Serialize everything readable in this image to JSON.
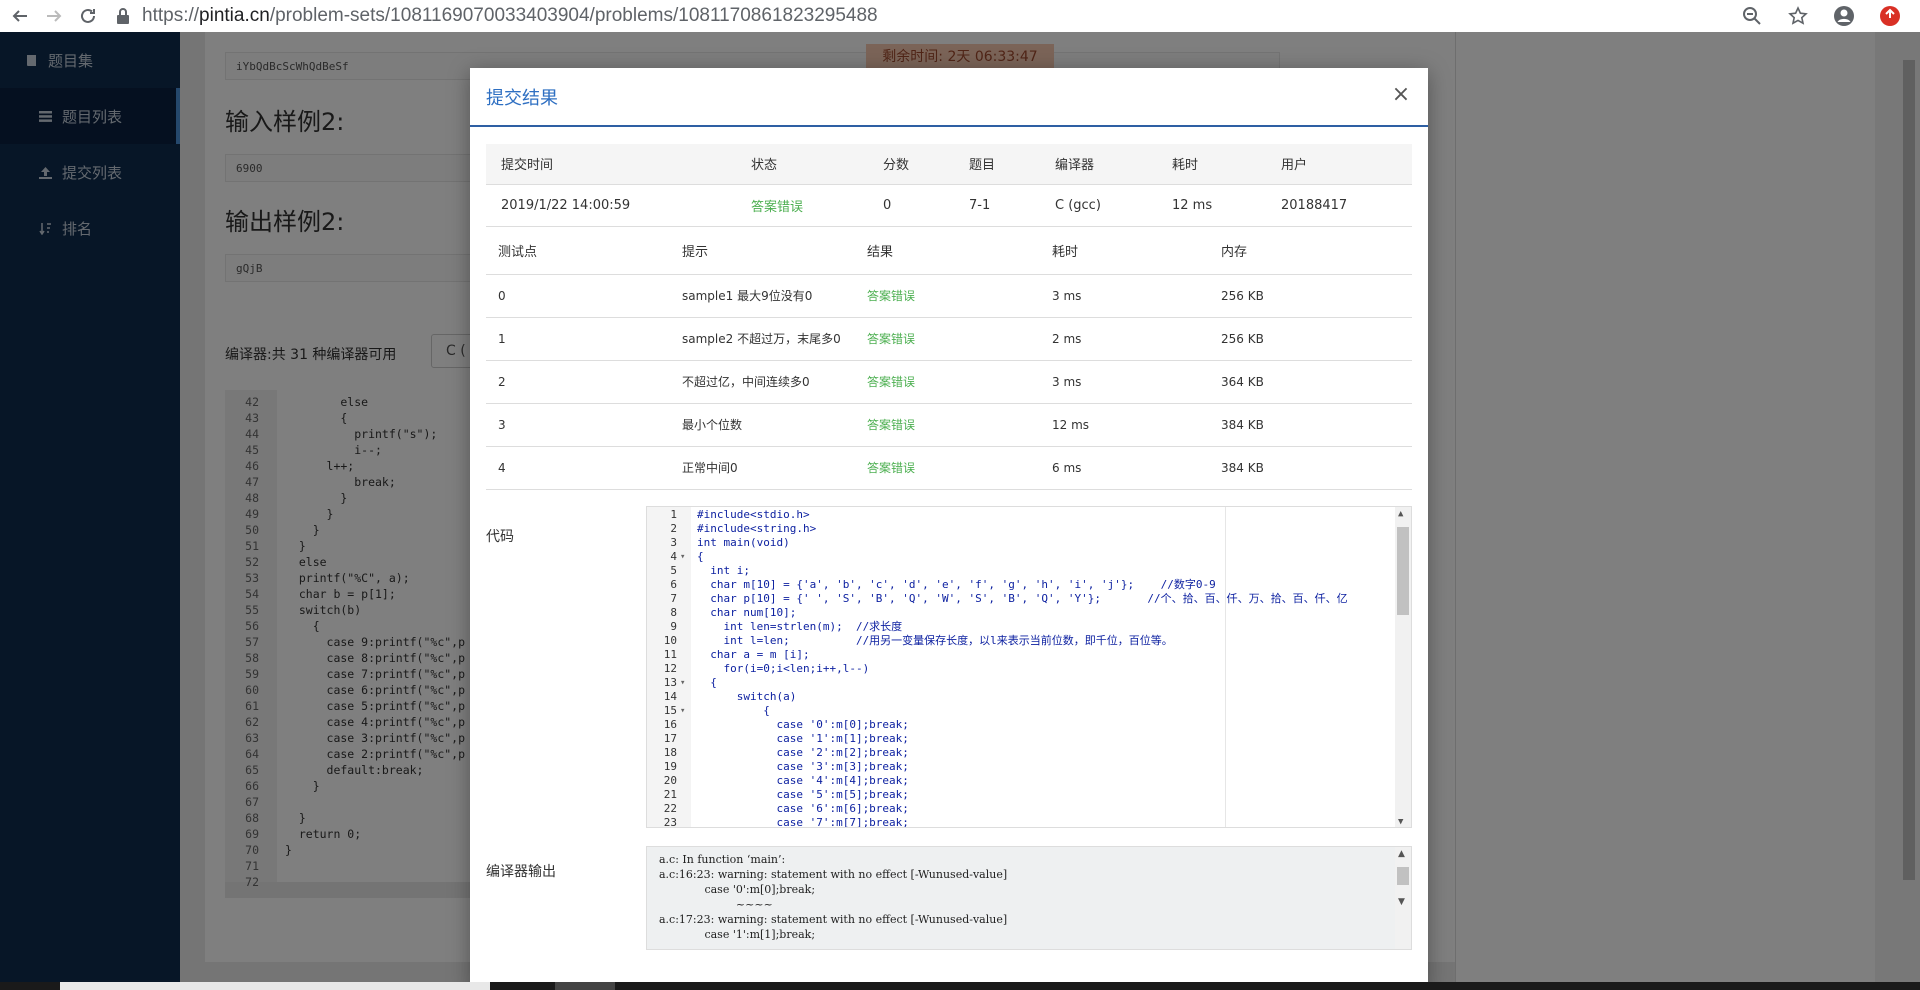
{
  "browser": {
    "url_scheme": "https://",
    "url_host": "pintia.cn",
    "url_path": "/problem-sets/1081169070033403904/problems/1081170861823295488"
  },
  "sidebar": {
    "items": [
      {
        "label": "题目集"
      },
      {
        "label": "题目列表"
      },
      {
        "label": "提交列表"
      },
      {
        "label": "排名"
      }
    ]
  },
  "background": {
    "sample_output_1_value": "iYbQdBcScWhQdBeSf",
    "sample_input_2_title": "输入样例2:",
    "sample_input_2_value": "6900",
    "sample_output_2_title": "输出样例2:",
    "sample_output_2_value": "gQjB",
    "timer": "剩余时间: 2天 06:33:47",
    "compiler_label": "编译器:共 31 种编译器可用",
    "compiler_select": "C (",
    "editor_lines": [
      {
        "no": "42",
        "text": "        else"
      },
      {
        "no": "43",
        "text": "        {"
      },
      {
        "no": "44",
        "text": "          printf(\"s\");"
      },
      {
        "no": "45",
        "text": "          i--;"
      },
      {
        "no": "46",
        "text": "      l++;"
      },
      {
        "no": "47",
        "text": "          break;"
      },
      {
        "no": "48",
        "text": "        }"
      },
      {
        "no": "49",
        "text": "      }"
      },
      {
        "no": "50",
        "text": "    }"
      },
      {
        "no": "51",
        "text": "  }"
      },
      {
        "no": "52",
        "text": "  else"
      },
      {
        "no": "53",
        "text": "  printf(\"%C\", a);"
      },
      {
        "no": "54",
        "text": "  char b = p[1];"
      },
      {
        "no": "55",
        "text": "  switch(b)"
      },
      {
        "no": "56",
        "text": "    {"
      },
      {
        "no": "57",
        "text": "      case 9:printf(\"%c\",p"
      },
      {
        "no": "58",
        "text": "      case 8:printf(\"%c\",p"
      },
      {
        "no": "59",
        "text": "      case 7:printf(\"%c\",p"
      },
      {
        "no": "60",
        "text": "      case 6:printf(\"%c\",p"
      },
      {
        "no": "61",
        "text": "      case 5:printf(\"%c\",p"
      },
      {
        "no": "62",
        "text": "      case 4:printf(\"%c\",p"
      },
      {
        "no": "63",
        "text": "      case 3:printf(\"%c\",p"
      },
      {
        "no": "64",
        "text": "      case 2:printf(\"%c\",p"
      },
      {
        "no": "65",
        "text": "      default:break;"
      },
      {
        "no": "66",
        "text": "    }"
      },
      {
        "no": "67",
        "text": ""
      },
      {
        "no": "68",
        "text": "  }"
      },
      {
        "no": "69",
        "text": "  return 0;"
      },
      {
        "no": "70",
        "text": "}"
      },
      {
        "no": "71",
        "text": ""
      },
      {
        "no": "72",
        "text": ""
      }
    ]
  },
  "modal": {
    "title": "提交结果",
    "close": "×",
    "submission_headers": [
      "提交时间",
      "状态",
      "分数",
      "题目",
      "编译器",
      "耗时",
      "用户"
    ],
    "submission_row": [
      "2019/1/22 14:00:59",
      "答案错误",
      "0",
      "7-1",
      "C (gcc)",
      "12 ms",
      "20188417"
    ],
    "test_headers": [
      "测试点",
      "提示",
      "结果",
      "耗时",
      "内存"
    ],
    "test_rows": [
      [
        "0",
        "sample1 最大9位没有0",
        "答案错误",
        "3 ms",
        "256 KB"
      ],
      [
        "1",
        "sample2 不超过万，末尾多0",
        "答案错误",
        "2 ms",
        "256 KB"
      ],
      [
        "2",
        "不超过亿，中间连续多0",
        "答案错误",
        "3 ms",
        "364 KB"
      ],
      [
        "3",
        "最小个位数",
        "答案错误",
        "12 ms",
        "384 KB"
      ],
      [
        "4",
        "正常中间0",
        "答案错误",
        "6 ms",
        "384 KB"
      ]
    ],
    "code_label": "代码",
    "code_lines": [
      {
        "no": "1",
        "fold": "",
        "text": "#include<stdio.h>"
      },
      {
        "no": "2",
        "fold": "",
        "text": "#include<string.h>"
      },
      {
        "no": "3",
        "fold": "",
        "text": "int main(void)"
      },
      {
        "no": "4",
        "fold": "▾",
        "text": "{"
      },
      {
        "no": "5",
        "fold": "",
        "text": "  int i;"
      },
      {
        "no": "6",
        "fold": "",
        "text": "  char m[10] = {'a', 'b', 'c', 'd', 'e', 'f', 'g', 'h', 'i', 'j'};    //数字0-9"
      },
      {
        "no": "7",
        "fold": "",
        "text": "  char p[10] = {' ', 'S', 'B', 'Q', 'W', 'S', 'B', 'Q', 'Y'};       //个、拾、百、仟、万、拾、百、仟、亿"
      },
      {
        "no": "8",
        "fold": "",
        "text": "  char num[10];"
      },
      {
        "no": "9",
        "fold": "",
        "text": "    int len=strlen(m);  //求长度"
      },
      {
        "no": "10",
        "fold": "",
        "text": "    int l=len;          //用另一变量保存长度，以l来表示当前位数，即千位，百位等。"
      },
      {
        "no": "11",
        "fold": "",
        "text": "  char a = m [i];"
      },
      {
        "no": "12",
        "fold": "",
        "text": "    for(i=0;i<len;i++,l--)"
      },
      {
        "no": "13",
        "fold": "▾",
        "text": "  {"
      },
      {
        "no": "14",
        "fold": "",
        "text": "      switch(a)"
      },
      {
        "no": "15",
        "fold": "▾",
        "text": "          {"
      },
      {
        "no": "16",
        "fold": "",
        "text": "            case '0':m[0];break;"
      },
      {
        "no": "17",
        "fold": "",
        "text": "            case '1':m[1];break;"
      },
      {
        "no": "18",
        "fold": "",
        "text": "            case '2':m[2];break;"
      },
      {
        "no": "19",
        "fold": "",
        "text": "            case '3':m[3];break;"
      },
      {
        "no": "20",
        "fold": "",
        "text": "            case '4':m[4];break;"
      },
      {
        "no": "21",
        "fold": "",
        "text": "            case '5':m[5];break;"
      },
      {
        "no": "22",
        "fold": "",
        "text": "            case '6':m[6];break;"
      },
      {
        "no": "23",
        "fold": "",
        "text": "            case '7':m[7];break;"
      }
    ],
    "compiler_output_label": "编译器输出",
    "compiler_output_lines": [
      "a.c: In function ‘main’:",
      "a.c:16:23: warning: statement with no effect [-Wunused-value]",
      "             case '0':m[0];break;",
      "                      ~~~~",
      "a.c:17:23: warning: statement with no effect [-Wunused-value]",
      "             case '1':m[1];break;"
    ]
  }
}
